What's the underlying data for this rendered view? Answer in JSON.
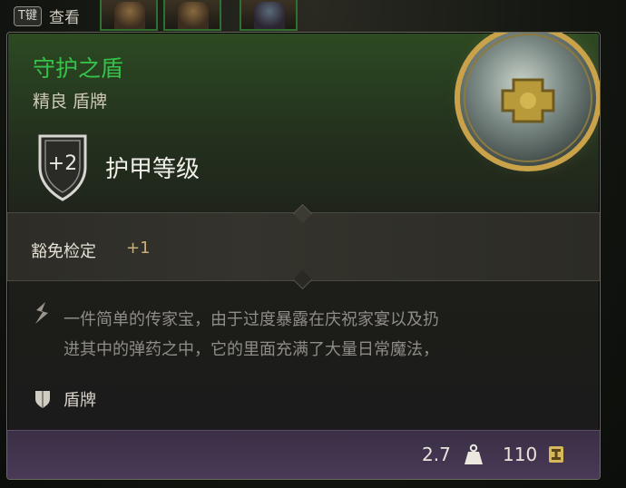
{
  "hotbar": {
    "key": "T键",
    "action": "查看"
  },
  "item": {
    "name": "守护之盾",
    "rarity_type": "精良 盾牌",
    "name_color": "#36c24a",
    "armor_bonus": "+2",
    "armor_label": "护甲等级",
    "save_label": "豁免检定",
    "save_bonus": "+1",
    "flavor_line1": "一件简单的传家宝，由于过度暴露在庆祝家宴以及扔",
    "flavor_line2": "进其中的弹药之中，它的里面充满了大量日常魔法，",
    "category": "盾牌",
    "weight": "2.7",
    "price": "110"
  },
  "icons": {
    "armor": "shield-outline-icon",
    "flavor": "quill-icon",
    "category": "shield-icon",
    "weight": "weight-icon",
    "price": "coin-icon",
    "art": "round-shield-art"
  }
}
